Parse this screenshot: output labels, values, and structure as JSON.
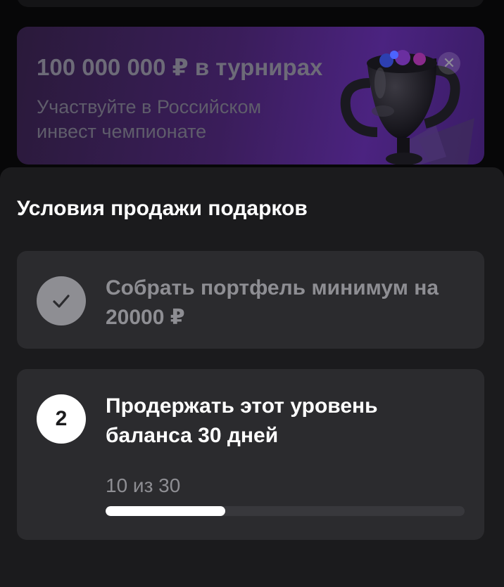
{
  "promo": {
    "title": "100 000 000 ₽ в турнирах",
    "subtitle": "Участвуйте в Российском инвест чемпионате",
    "close_symbol": "✕"
  },
  "sheet": {
    "title": "Условия продажи подарков",
    "conditions": [
      {
        "status": "done",
        "icon": "check-icon",
        "text": "Собрать портфель минимум на 20000 ₽"
      },
      {
        "status": "in-progress",
        "number": "2",
        "text": "Продержать этот уровень баланса 30 дней",
        "progress_label": "10 из 30",
        "progress_current": 10,
        "progress_total": 30
      }
    ]
  },
  "colors": {
    "sheet_bg": "#1b1b1d",
    "card_bg": "#2b2b2e",
    "muted_text": "#8e8e93",
    "accent_white": "#ffffff",
    "promo_purple": "#4b2380"
  }
}
